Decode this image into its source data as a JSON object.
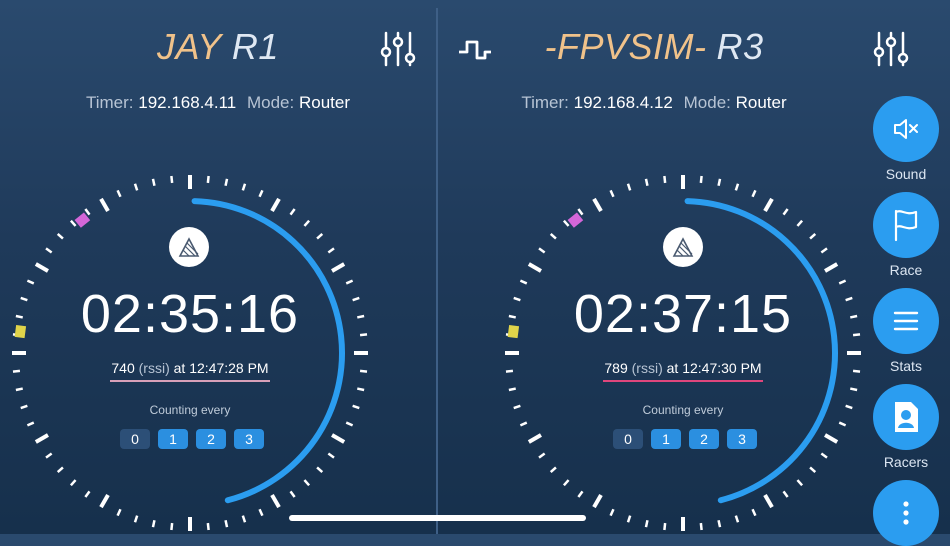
{
  "left": {
    "pilot": "JAY",
    "round": "R1",
    "timer_label": "Timer:",
    "timer_ip": "192.168.4.11",
    "mode_label": "Mode:",
    "mode": "Router",
    "time": "02:35:16",
    "rssi_value": "740",
    "rssi_unit": "(rssi)",
    "rssi_at": "at 12:47:28 PM",
    "rssi_line_color": "#d8a0b8",
    "counting_label": "Counting every",
    "counts": [
      "0",
      "1",
      "2",
      "3"
    ],
    "progress": 0.46
  },
  "right": {
    "pilot": "-FPVSIM-",
    "round": "R3",
    "timer_label": "Timer:",
    "timer_ip": "192.168.4.12",
    "mode_label": "Mode:",
    "mode": "Router",
    "time": "02:37:15",
    "rssi_value": "789",
    "rssi_unit": "(rssi)",
    "rssi_at": "at 12:47:30 PM",
    "rssi_line_color": "#e0467c",
    "counting_label": "Counting every",
    "counts": [
      "0",
      "1",
      "2",
      "3"
    ],
    "progress": 0.46
  },
  "sidebar": {
    "sound": "Sound",
    "race": "Race",
    "stats": "Stats",
    "racers": "Racers"
  },
  "colors": {
    "accent": "#2b9df0",
    "pilot": "#f0c28a",
    "marker_magenta": "#d466d8",
    "marker_yellow": "#e0d44a"
  },
  "icons": [
    "settings-sliders-icon",
    "signal-pulse-icon",
    "laptimer-logo-icon",
    "speaker-mute-icon",
    "flag-icon",
    "menu-lines-icon",
    "racer-badge-icon",
    "more-dots-icon"
  ]
}
